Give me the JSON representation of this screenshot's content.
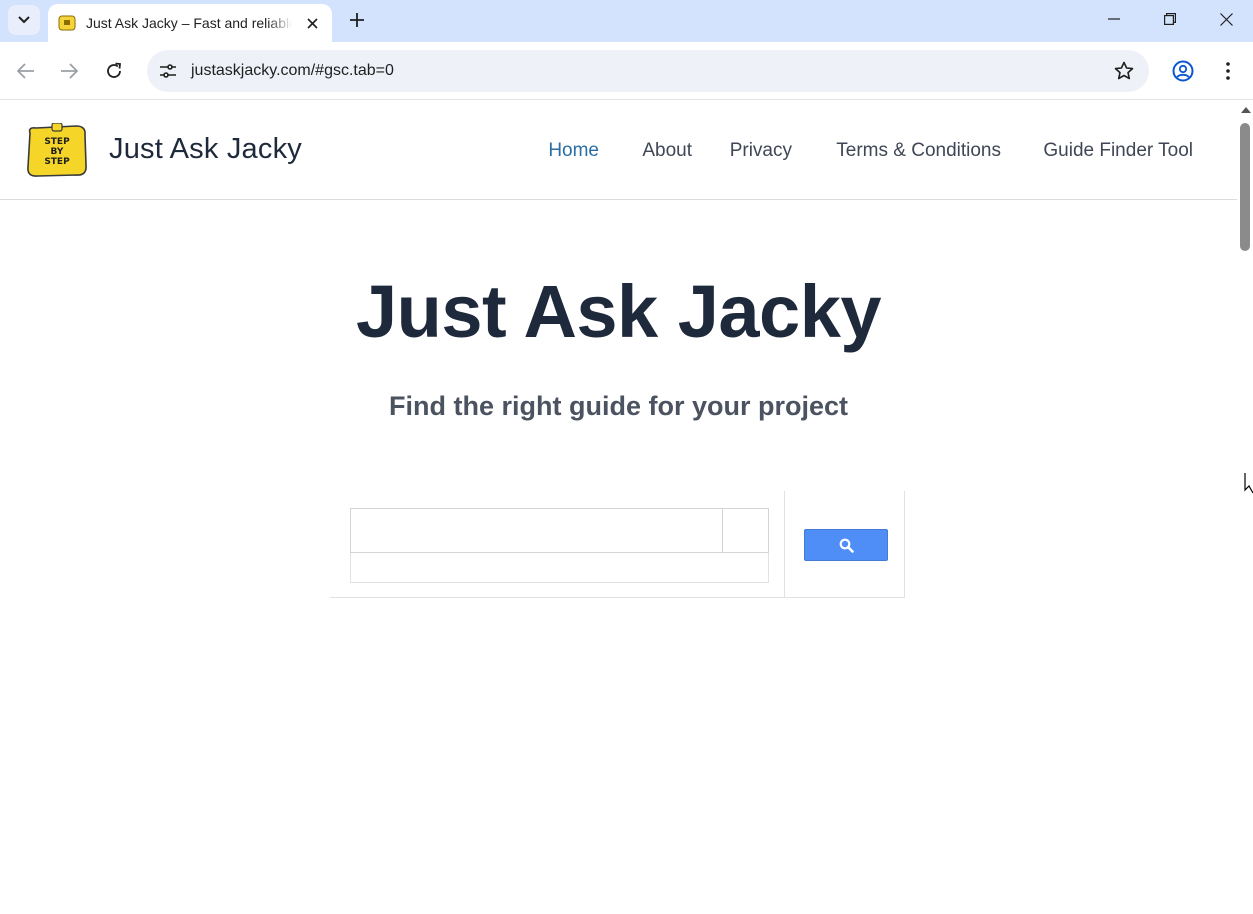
{
  "browser": {
    "tab": {
      "title": "Just Ask Jacky – Fast and reliable"
    },
    "url": "justaskjacky.com/#gsc.tab=0"
  },
  "site": {
    "logo": {
      "text_line1": "STEP",
      "text_line2": "BY",
      "text_line3": "STEP"
    },
    "title": "Just Ask Jacky",
    "nav": [
      {
        "label": "Home",
        "active": true
      },
      {
        "label": "About",
        "active": false
      },
      {
        "label": "Privacy",
        "active": false
      },
      {
        "label": "Terms & Conditions",
        "active": false
      },
      {
        "label": "Guide Finder Tool",
        "active": false
      }
    ]
  },
  "hero": {
    "title": "Just Ask Jacky",
    "subtitle": "Find the right guide for your project"
  },
  "search": {
    "value": "",
    "button_icon": "search-icon"
  },
  "colors": {
    "tabbar": "#d3e3fd",
    "nav_active": "#2a6ea5",
    "heading": "#1e293b",
    "search_button": "#4f8ef7"
  }
}
